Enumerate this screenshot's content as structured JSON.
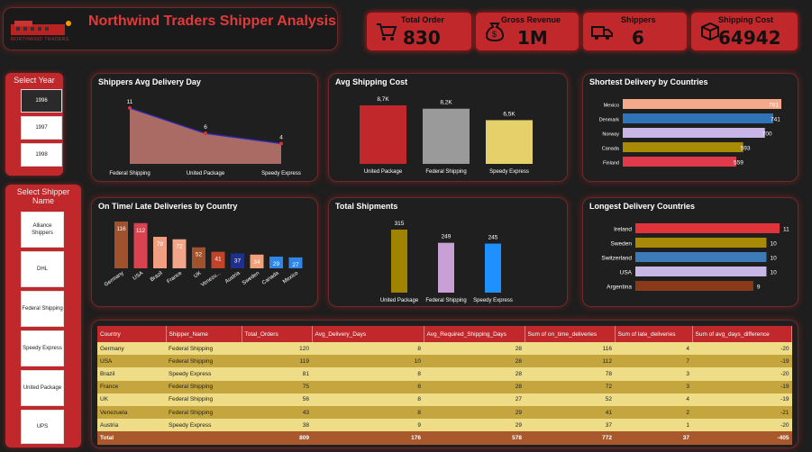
{
  "header": {
    "title": "Northwind Traders Shipper Analysis",
    "logo_text": "NORTHWIND TRADERS"
  },
  "kpis": [
    {
      "label": "Total Order",
      "value": "830",
      "icon": "shopping-cart-icon"
    },
    {
      "label": "Gross Revenue",
      "value": "1M",
      "icon": "money-bag-icon"
    },
    {
      "label": "Shippers",
      "value": "6",
      "icon": "delivery-truck-icon"
    },
    {
      "label": "Shipping Cost",
      "value": "64942",
      "icon": "shipping-box-icon"
    }
  ],
  "year_slicer": {
    "title": "Select Year",
    "items": [
      "1996",
      "1997",
      "1998"
    ],
    "selected": "1996"
  },
  "shipper_slicer": {
    "title": "Select Shipper Name",
    "items": [
      "Alliance Shippers",
      "DHL",
      "Federal Shipping",
      "Speedy Express",
      "United Package",
      "UPS"
    ]
  },
  "charts": {
    "avg_delivery": {
      "title": "Shippers Avg Delivery Day",
      "chart_data": {
        "type": "area",
        "categories": [
          "Federal Shipping",
          "United Package",
          "Speedy Express"
        ],
        "values": [
          11,
          6,
          4
        ],
        "labels": [
          "11",
          "6",
          "4"
        ]
      }
    },
    "avg_shipping_cost": {
      "title": "Avg Shipping Cost",
      "chart_data": {
        "type": "bar",
        "categories": [
          "United Package",
          "Federal Shipping",
          "Speedy Express"
        ],
        "values": [
          8700,
          8200,
          6500
        ],
        "labels": [
          "8,7K",
          "8,2K",
          "6,5K"
        ],
        "colors": [
          "#c0282b",
          "#9a9a9a",
          "#e6d06a"
        ]
      }
    },
    "shortest_delivery": {
      "title": "Shortest Delivery by Countries",
      "chart_data": {
        "type": "bar",
        "orientation": "horizontal",
        "categories": [
          "Mexico",
          "Denmark",
          "Norway",
          "Canada",
          "Finland"
        ],
        "values": [
          781,
          741,
          700,
          593,
          559
        ],
        "colors": [
          "#f4a98a",
          "#2f74b8",
          "#c8b6e6",
          "#a88a06",
          "#e0394a"
        ]
      }
    },
    "on_time_late": {
      "title": "On Time/ Late Deliveries by Country",
      "chart_data": {
        "type": "bar",
        "categories": [
          "Germany",
          "USA",
          "Brazil",
          "France",
          "UK",
          "Venezu...",
          "Austria",
          "Sweden",
          "Canada",
          "Mexico"
        ],
        "values": [
          116,
          112,
          78,
          72,
          52,
          41,
          37,
          34,
          29,
          27
        ],
        "colors": [
          "#a0522d",
          "#d9434f",
          "#f0a080",
          "#f3a58a",
          "#a0522d",
          "#c1432a",
          "#1f2f8a",
          "#f2a07a",
          "#2f86e6",
          "#2f86e6"
        ]
      }
    },
    "total_shipments": {
      "title": "Total Shipments",
      "chart_data": {
        "type": "bar",
        "categories": [
          "United Package",
          "Federal Shipping",
          "Speedy Express"
        ],
        "values": [
          315,
          249,
          245
        ],
        "colors": [
          "#a08400",
          "#c9a0d6",
          "#1e90ff"
        ]
      }
    },
    "longest_delivery": {
      "title": "Longest Delivery Countries",
      "chart_data": {
        "type": "bar",
        "orientation": "horizontal",
        "categories": [
          "Ireland",
          "Sweden",
          "Switzerland",
          "USA",
          "Argentina"
        ],
        "values": [
          11,
          10,
          10,
          10,
          9
        ],
        "colors": [
          "#e0343a",
          "#a88a06",
          "#3d7bb8",
          "#c8b6e6",
          "#8a3a18"
        ]
      }
    }
  },
  "table": {
    "columns": [
      "Country",
      "Shipper_Name",
      "Total_Orders",
      "Avg_Delivery_Days",
      "Avg_Required_Shipping_Days",
      "Sum of on_time_deliveries",
      "Sum of late_deliveries",
      "Sum of avg_days_difference"
    ],
    "rows": [
      [
        "Germany",
        "Federal Shipping",
        "120",
        "8",
        "28",
        "116",
        "4",
        "-20"
      ],
      [
        "USA",
        "Federal Shipping",
        "119",
        "10",
        "28",
        "112",
        "7",
        "-19"
      ],
      [
        "Brazil",
        "Speedy Express",
        "81",
        "8",
        "28",
        "78",
        "3",
        "-20"
      ],
      [
        "France",
        "Federal Shipping",
        "75",
        "8",
        "28",
        "72",
        "3",
        "-19"
      ],
      [
        "UK",
        "Federal Shipping",
        "56",
        "8",
        "27",
        "52",
        "4",
        "-19"
      ],
      [
        "Venezuela",
        "Federal Shipping",
        "43",
        "8",
        "29",
        "41",
        "2",
        "-21"
      ],
      [
        "Austria",
        "Speedy Express",
        "38",
        "9",
        "29",
        "37",
        "1",
        "-20"
      ]
    ],
    "total": [
      "Total",
      "",
      "809",
      "176",
      "578",
      "772",
      "37",
      "-405"
    ]
  }
}
